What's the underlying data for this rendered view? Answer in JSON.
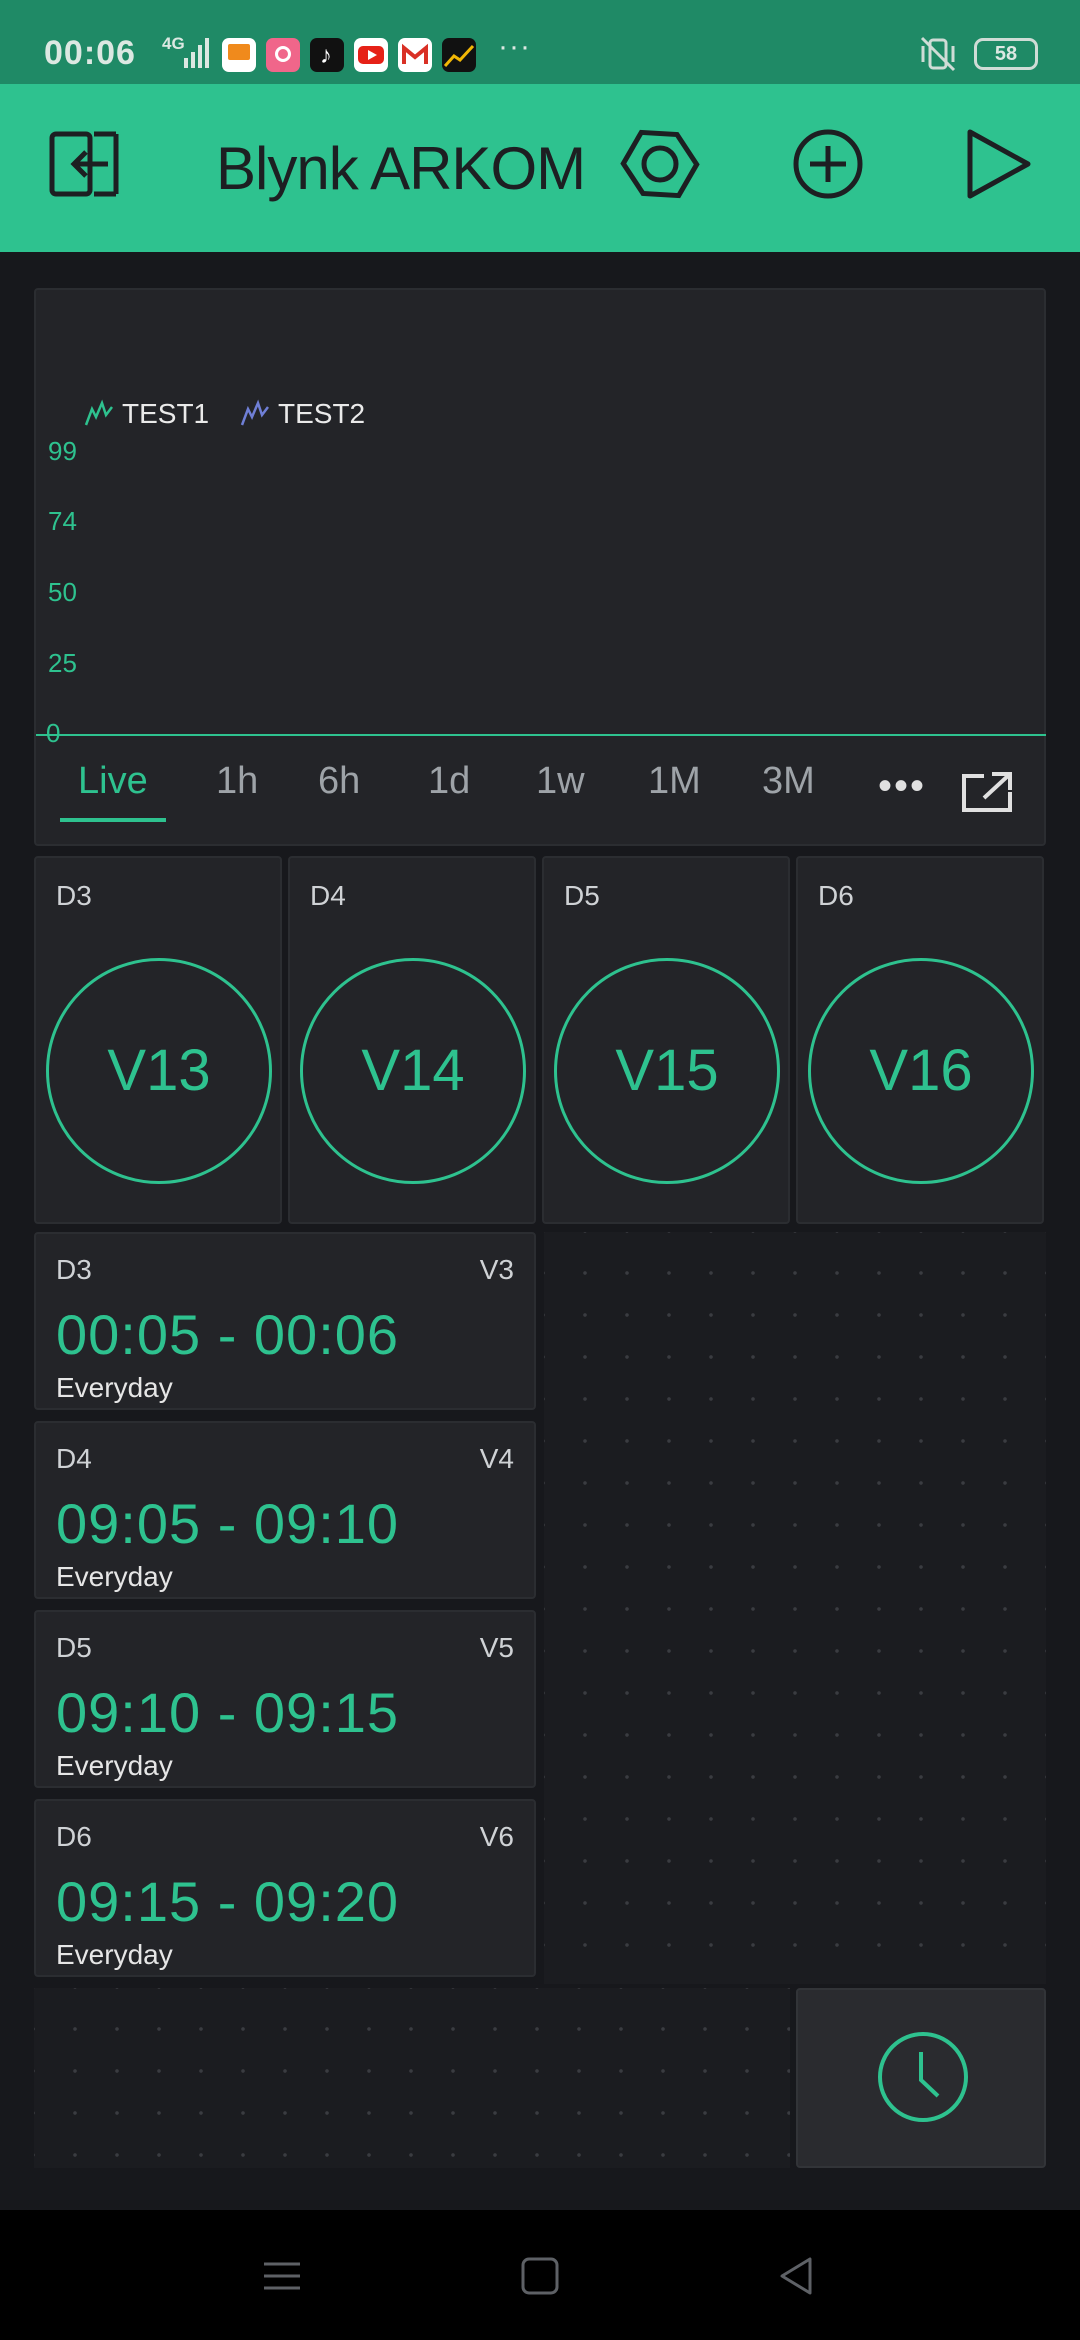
{
  "status_bar": {
    "time": "00:06",
    "network": "4G",
    "battery": "58",
    "icons": [
      "signal-icon",
      "slides-app-icon",
      "pen-app-icon",
      "tiktok-icon",
      "youtube-icon",
      "gmail-icon",
      "investing-icon",
      "more-icon",
      "vibrate-mute-icon",
      "battery-icon"
    ]
  },
  "header": {
    "title": "Blynk ARKOM",
    "icons": [
      "exit-icon",
      "settings-hexagon-icon",
      "add-widget-icon",
      "play-icon"
    ]
  },
  "graph": {
    "legend": [
      "TEST1",
      "TEST2"
    ],
    "legend_colors": [
      "#2ec28f",
      "#6f7fd6"
    ],
    "y_ticks": [
      "99",
      "74",
      "50",
      "25",
      "0"
    ],
    "ranges": [
      "Live",
      "1h",
      "6h",
      "1d",
      "1w",
      "1M",
      "3M"
    ],
    "active_range": "Live",
    "icons": [
      "more-dots-icon",
      "expand-icon"
    ]
  },
  "buttons": [
    {
      "pin": "D3",
      "label": "V13"
    },
    {
      "pin": "D4",
      "label": "V14"
    },
    {
      "pin": "D5",
      "label": "V15"
    },
    {
      "pin": "D6",
      "label": "V16"
    }
  ],
  "timers": [
    {
      "pin": "D3",
      "vpin": "V3",
      "range": "00:05 - 00:06",
      "days": "Everyday"
    },
    {
      "pin": "D4",
      "vpin": "V4",
      "range": "09:05 - 09:10",
      "days": "Everyday"
    },
    {
      "pin": "D5",
      "vpin": "V5",
      "range": "09:10 - 09:15",
      "days": "Everyday"
    },
    {
      "pin": "D6",
      "vpin": "V6",
      "range": "09:15 - 09:20",
      "days": "Everyday"
    }
  ],
  "colors": {
    "accent": "#2ec28f",
    "status_bar": "#1f8a66",
    "background": "#17181c",
    "widget": "#232428"
  },
  "nav": [
    "menu-icon",
    "home-icon",
    "back-icon"
  ]
}
